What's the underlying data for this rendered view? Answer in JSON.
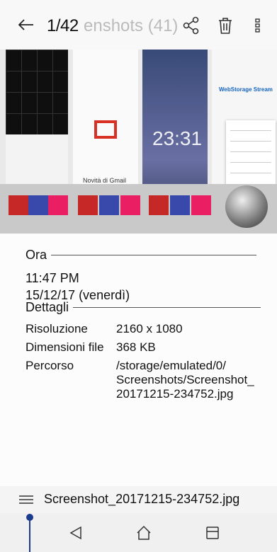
{
  "topbar": {
    "counter": "1/42",
    "ghost_title": "enshots (41)",
    "icons": [
      "back-arrow-icon",
      "share-icon",
      "trash-icon",
      "more-vert-icon"
    ]
  },
  "info": {
    "time_heading": "Ora",
    "time": "11:47 PM",
    "date": "15/12/17 (venerdì)",
    "details_heading": "Dettagli",
    "rows": [
      {
        "key": "Risoluzione",
        "value": "2160 x 1080"
      },
      {
        "key": "Dimensioni file",
        "value": "368 KB"
      },
      {
        "key": "Percorso",
        "value": "/storage/emulated/0/ Screenshots/Screenshot_ 20171215-234752.jpg"
      }
    ]
  },
  "file": {
    "name": "Screenshot_20171215-234752.jpg"
  },
  "background": {
    "tile_texts": {
      "gmail": "Novità di Gmail",
      "clock": "23:31",
      "webstorage": "WebStorage Stream"
    }
  },
  "colors": {
    "accent": "#1b3b8c",
    "text": "#111111"
  },
  "navbar": {
    "icons": [
      "nav-back-icon",
      "nav-home-icon",
      "nav-recents-icon"
    ]
  }
}
